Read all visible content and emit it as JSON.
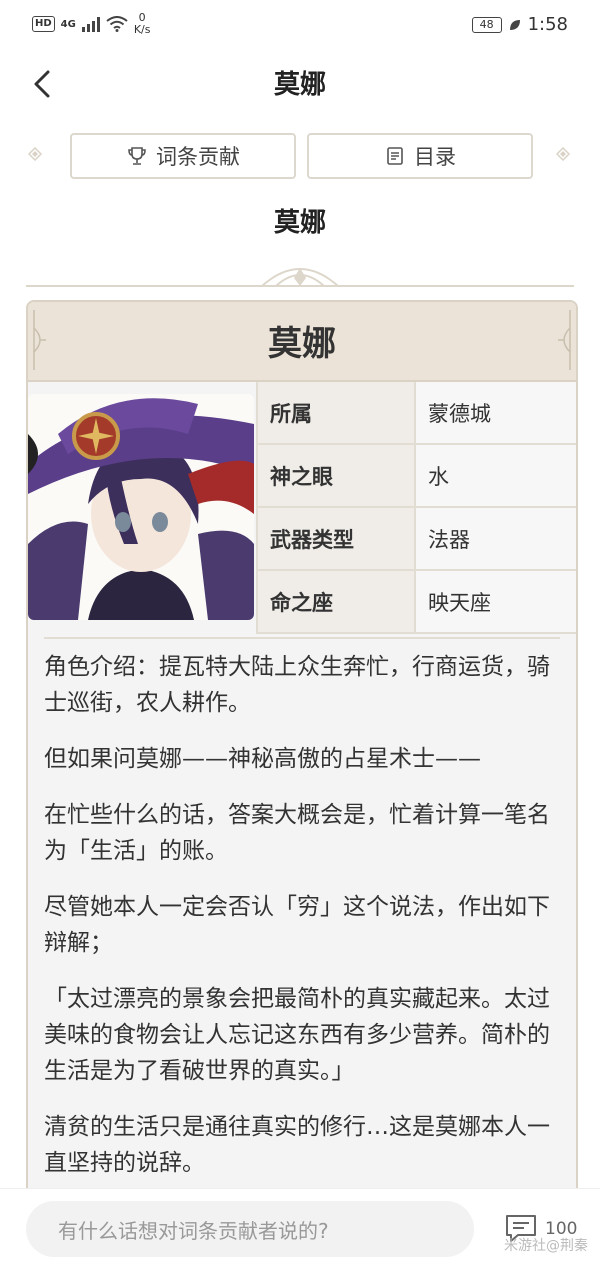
{
  "status_bar": {
    "network": "HD",
    "net_type": "4G",
    "speed_value": "0",
    "speed_unit": "K/s",
    "battery": "48",
    "time": "1:58"
  },
  "nav": {
    "title": "莫娜"
  },
  "actions": {
    "contribute_label": "词条贡献",
    "catalog_label": "目录"
  },
  "subtitle": "莫娜",
  "card": {
    "name": "莫娜",
    "attributes": [
      {
        "key": "所属",
        "value": "蒙德城"
      },
      {
        "key": "神之眼",
        "value": "水"
      },
      {
        "key": "武器类型",
        "value": "法器"
      },
      {
        "key": "命之座",
        "value": "映天座"
      }
    ],
    "paragraphs": [
      "角色介绍：提瓦特大陆上众生奔忙，行商运货，骑士巡街，农人耕作。",
      "但如果问莫娜——神秘高傲的占星术士——",
      "在忙些什么的话，答案大概会是，忙着计算一笔名为「生活」的账。",
      "尽管她本人一定会否认「穷」这个说法，作出如下辩解；",
      "「太过漂亮的景象会把最简朴的真实藏起来。太过美味的食物会让人忘记这东西有多少营养。简朴的生活是为了看破世界的真实。」",
      "清贫的生活只是通往真实的修行…这是莫娜本人一直坚持的说辞。"
    ]
  },
  "bottom": {
    "comment_placeholder": "有什么话想对词条贡献者说的?",
    "comment_count": "100",
    "watermark": "米游社@荆秦"
  },
  "colors": {
    "accent": "#d9d2c5",
    "header_bg": "#ebe3d7"
  }
}
